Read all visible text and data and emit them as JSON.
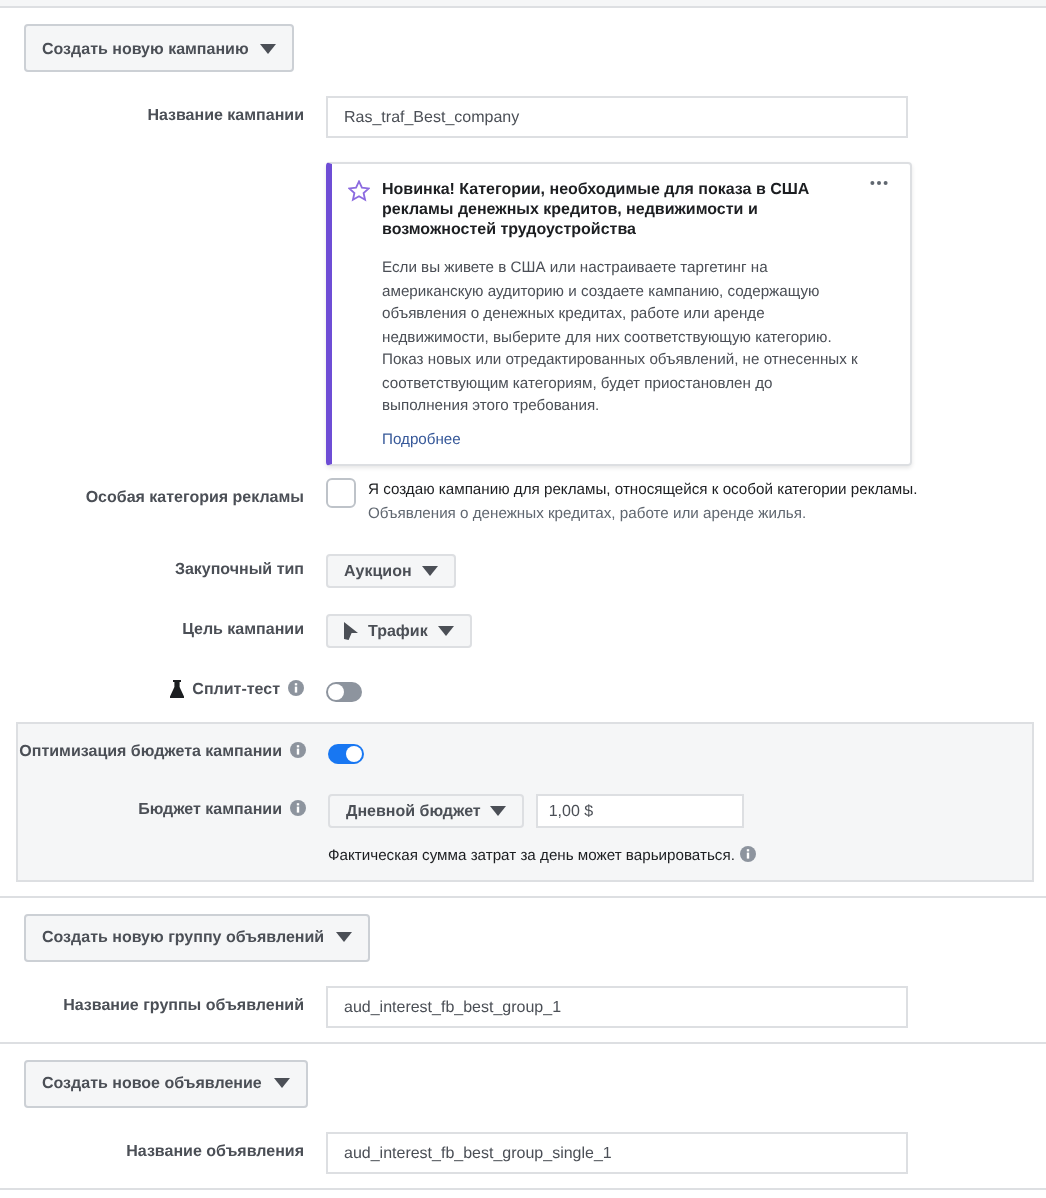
{
  "campaign": {
    "create_button": "Создать новую кампанию",
    "name_label": "Название кампании",
    "name_value": "Ras_traf_Best_company",
    "notice": {
      "title": "Новинка! Категории, необходимые для показа в США рекламы денежных кредитов, недвижимости и возможностей трудоустройства",
      "body": "Если вы живете в США или настраиваете таргетинг на американскую аудиторию и создаете кампанию, содержащую объявления о денежных кредитах, работе или аренде недвижимости, выберите для них соответствующую категорию. Показ новых или отредактированных объявлений, не отнесенных к соответствующим категориям, будет приостановлен до выполнения этого требования.",
      "link": "Подробнее"
    },
    "special_category": {
      "label": "Особая категория рекламы",
      "checked": false,
      "text": "Я создаю кампанию для рекламы, относящейся к особой категории рекламы.",
      "hint": "Объявления о денежных кредитах, работе или аренде жилья."
    },
    "buying_type": {
      "label": "Закупочный тип",
      "value": "Аукцион"
    },
    "objective": {
      "label": "Цель кампании",
      "value": "Трафик"
    },
    "split_test": {
      "label": "Сплит-тест",
      "on": false
    },
    "budget_optimization": {
      "label": "Оптимизация бюджета кампании",
      "on": true
    },
    "budget": {
      "label": "Бюджет кампании",
      "type": "Дневной бюджет",
      "value": "1,00 $",
      "note": "Фактическая сумма затрат за день может варьироваться."
    }
  },
  "ad_set": {
    "create_button": "Создать новую группу объявлений",
    "name_label": "Название группы объявлений",
    "name_value": "aud_interest_fb_best_group_1"
  },
  "ad": {
    "create_button": "Создать новое объявление",
    "name_label": "Название объявления",
    "name_value": "aud_interest_fb_best_group_single_1"
  }
}
